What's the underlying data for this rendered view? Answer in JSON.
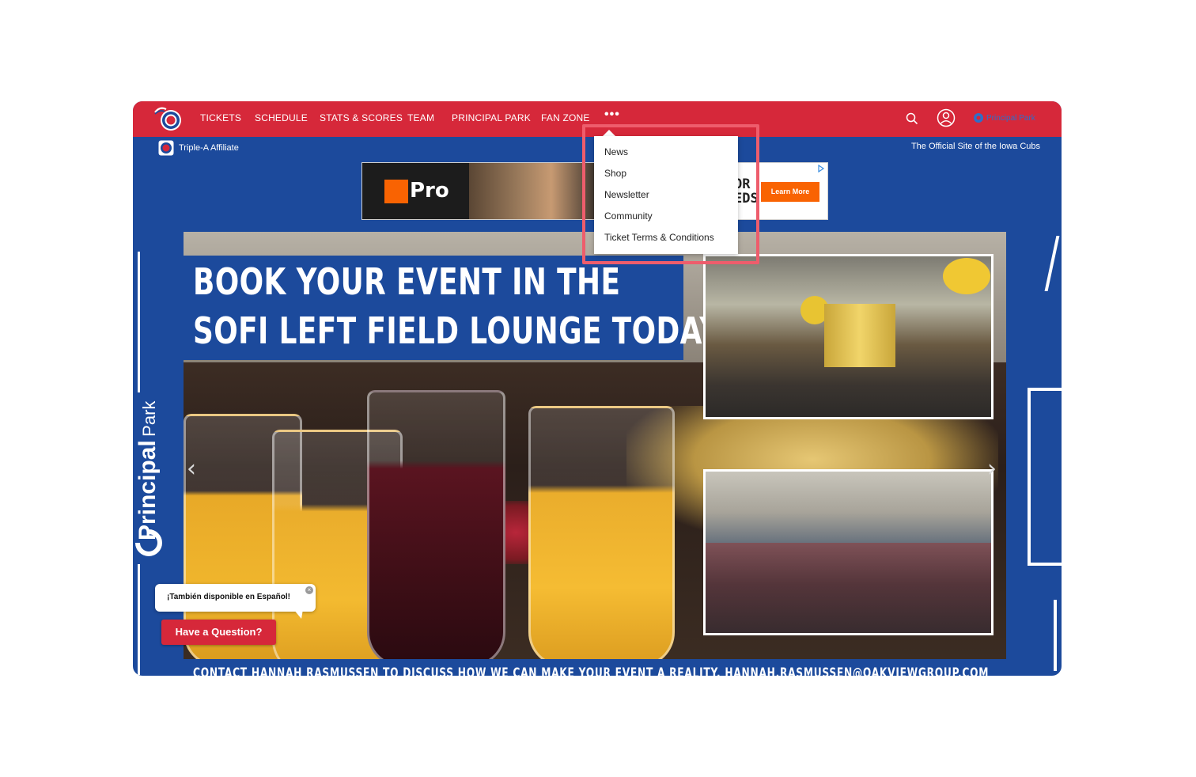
{
  "nav": {
    "items": [
      "TICKETS",
      "SCHEDULE",
      "STATS & SCORES",
      "TEAM",
      "PRINCIPAL PARK",
      "FAN ZONE"
    ],
    "more": "•••",
    "park_logo_text": "Principal Park"
  },
  "subbar": {
    "affiliate": "Triple-A Affiliate",
    "official": "The Official Site of the Iowa Cubs"
  },
  "ad": {
    "brand": "Pro",
    "partial_text": "OR\nEDS",
    "cta": "Learn More"
  },
  "hero": {
    "headline_line1": "BOOK YOUR EVENT IN THE",
    "headline_line2": "SOFI LEFT FIELD LOUNGE TODAY",
    "caption": "CONTACT HANNAH RASMUSSEN TO DISCUSS HOW WE CAN MAKE YOUR EVENT A REALITY. HANNAH.RASMUSSEN@OAKVIEWGROUP.COM",
    "prev_arrow": "‹",
    "next_arrow": "›"
  },
  "side": {
    "brand": "Principal",
    "word": "Park"
  },
  "chat": {
    "espanol": "¡También disponible en Español!",
    "close": "×",
    "question": "Have a Question?"
  },
  "dropdown": {
    "items": [
      "News",
      "Shop",
      "Newsletter",
      "Community",
      "Ticket Terms & Conditions"
    ]
  },
  "colors": {
    "nav_red": "#d6283a",
    "cubs_blue": "#1c4a9c",
    "home_depot_orange": "#f96302",
    "highlight": "#ee5d6c"
  }
}
